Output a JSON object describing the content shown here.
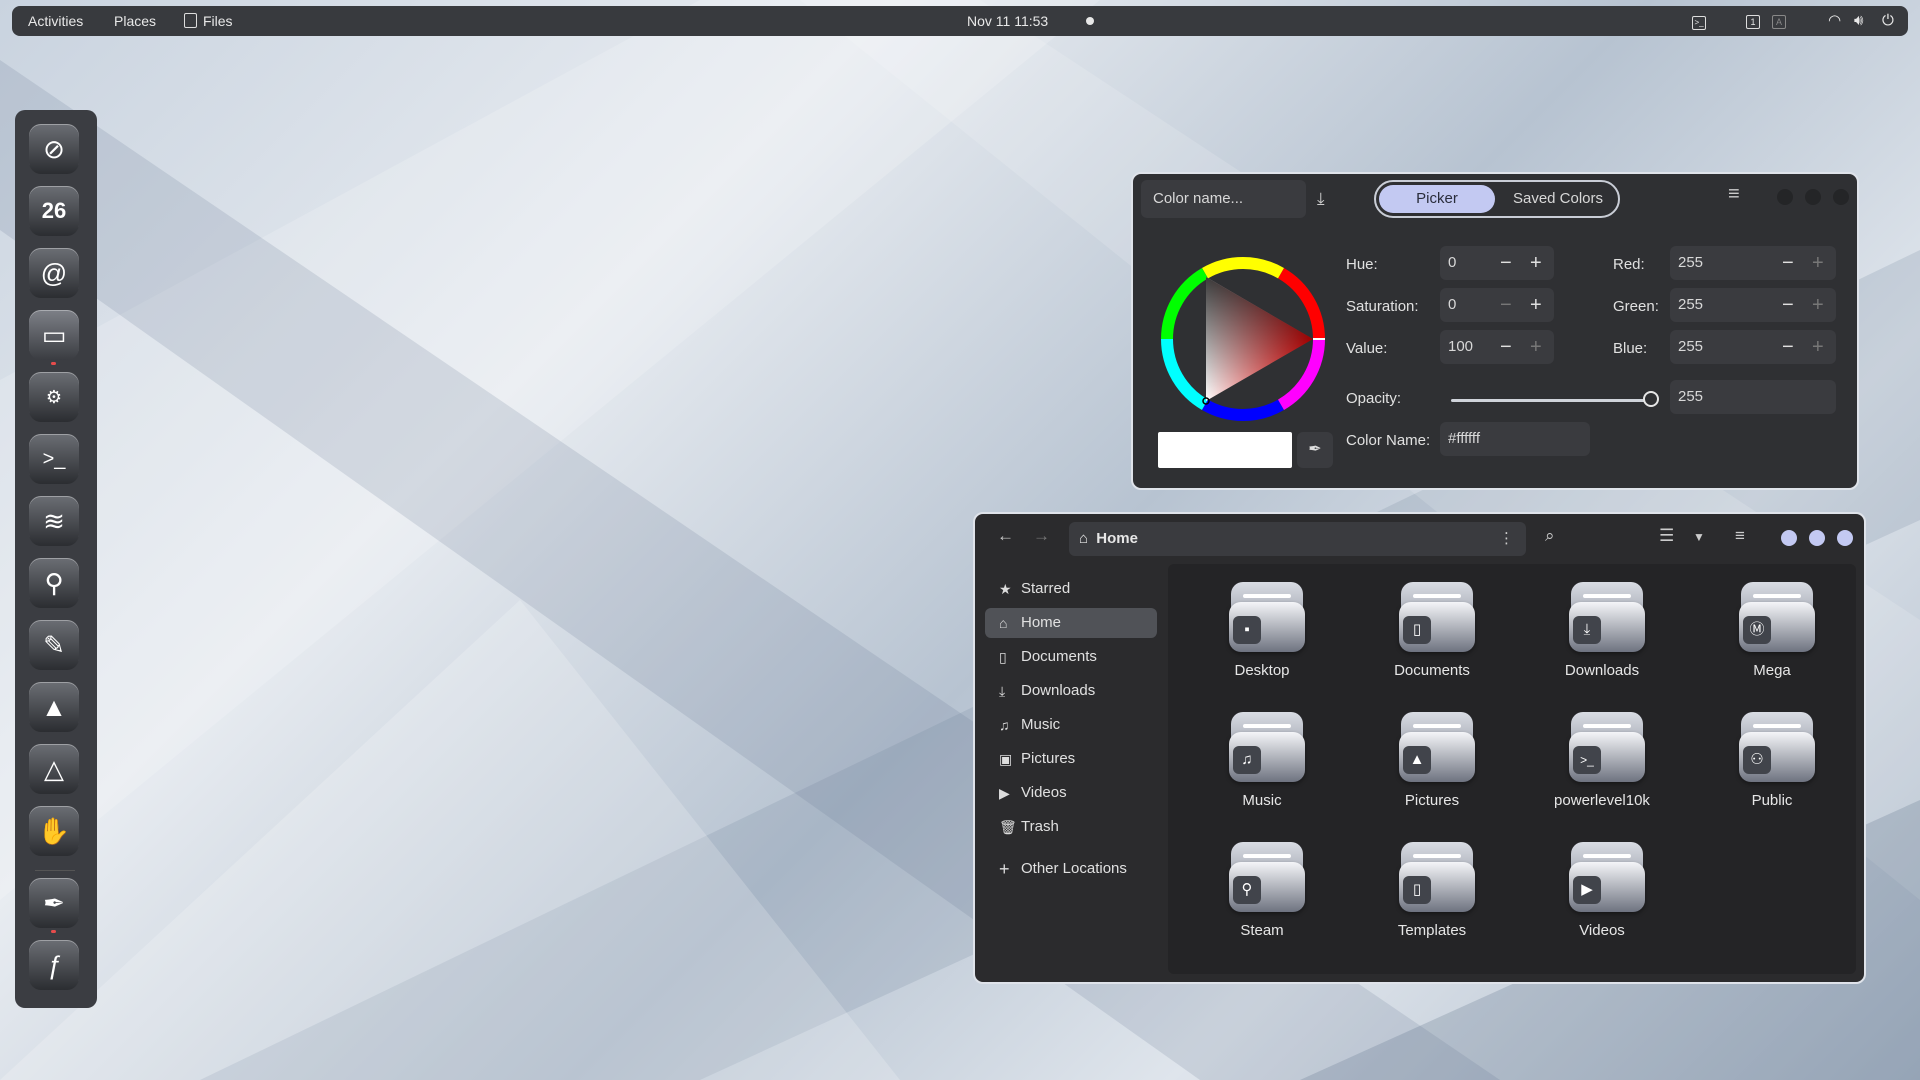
{
  "topbar": {
    "activities": "Activities",
    "places": "Places",
    "files": "Files",
    "clock": "Nov 11  11:53"
  },
  "dock": {
    "items": [
      "browser-icon",
      "calendar-icon",
      "mail-icon",
      "files-icon",
      "tweaks-icon",
      "terminal-icon",
      "rss-icon",
      "steam-icon",
      "paint-icon",
      "inkscape-icon",
      "blender-icon",
      "gimp-icon",
      "color-picker-icon",
      "fedora-icon"
    ],
    "calendar_day": "26"
  },
  "picker": {
    "color_name_placeholder": "Color name...",
    "tab_picker": "Picker",
    "tab_saved": "Saved Colors",
    "hue_label": "Hue:",
    "hue_value": "0",
    "saturation_label": "Saturation:",
    "saturation_value": "0",
    "value_label": "Value:",
    "value_value": "100",
    "red_label": "Red:",
    "red_value": "255",
    "green_label": "Green:",
    "green_value": "255",
    "blue_label": "Blue:",
    "blue_value": "255",
    "opacity_label": "Opacity:",
    "opacity_value": "255",
    "opacity_fraction": 1.0,
    "color_name_label": "Color Name:",
    "color_name_value": "#ffffff",
    "swatch_color": "#ffffff"
  },
  "files": {
    "path": "Home",
    "sidebar": [
      {
        "label": "Starred",
        "icon": "star-icon"
      },
      {
        "label": "Home",
        "icon": "home-icon"
      },
      {
        "label": "Documents",
        "icon": "document-icon"
      },
      {
        "label": "Downloads",
        "icon": "download-icon"
      },
      {
        "label": "Music",
        "icon": "music-icon"
      },
      {
        "label": "Pictures",
        "icon": "picture-icon"
      },
      {
        "label": "Videos",
        "icon": "video-icon"
      },
      {
        "label": "Trash",
        "icon": "trash-icon"
      },
      {
        "label": "Other Locations",
        "icon": "plus-icon"
      }
    ],
    "folders": [
      {
        "label": "Desktop",
        "icon": "desktop-icon"
      },
      {
        "label": "Documents",
        "icon": "document-icon"
      },
      {
        "label": "Downloads",
        "icon": "download-icon"
      },
      {
        "label": "Mega",
        "icon": "mega-icon"
      },
      {
        "label": "Music",
        "icon": "music-icon"
      },
      {
        "label": "Pictures",
        "icon": "picture-icon"
      },
      {
        "label": "powerlevel10k",
        "icon": "terminal-icon"
      },
      {
        "label": "Public",
        "icon": "people-icon"
      },
      {
        "label": "Steam",
        "icon": "steam-icon"
      },
      {
        "label": "Templates",
        "icon": "template-icon"
      },
      {
        "label": "Videos",
        "icon": "video-icon"
      }
    ],
    "accent": "#c3c9f2"
  }
}
